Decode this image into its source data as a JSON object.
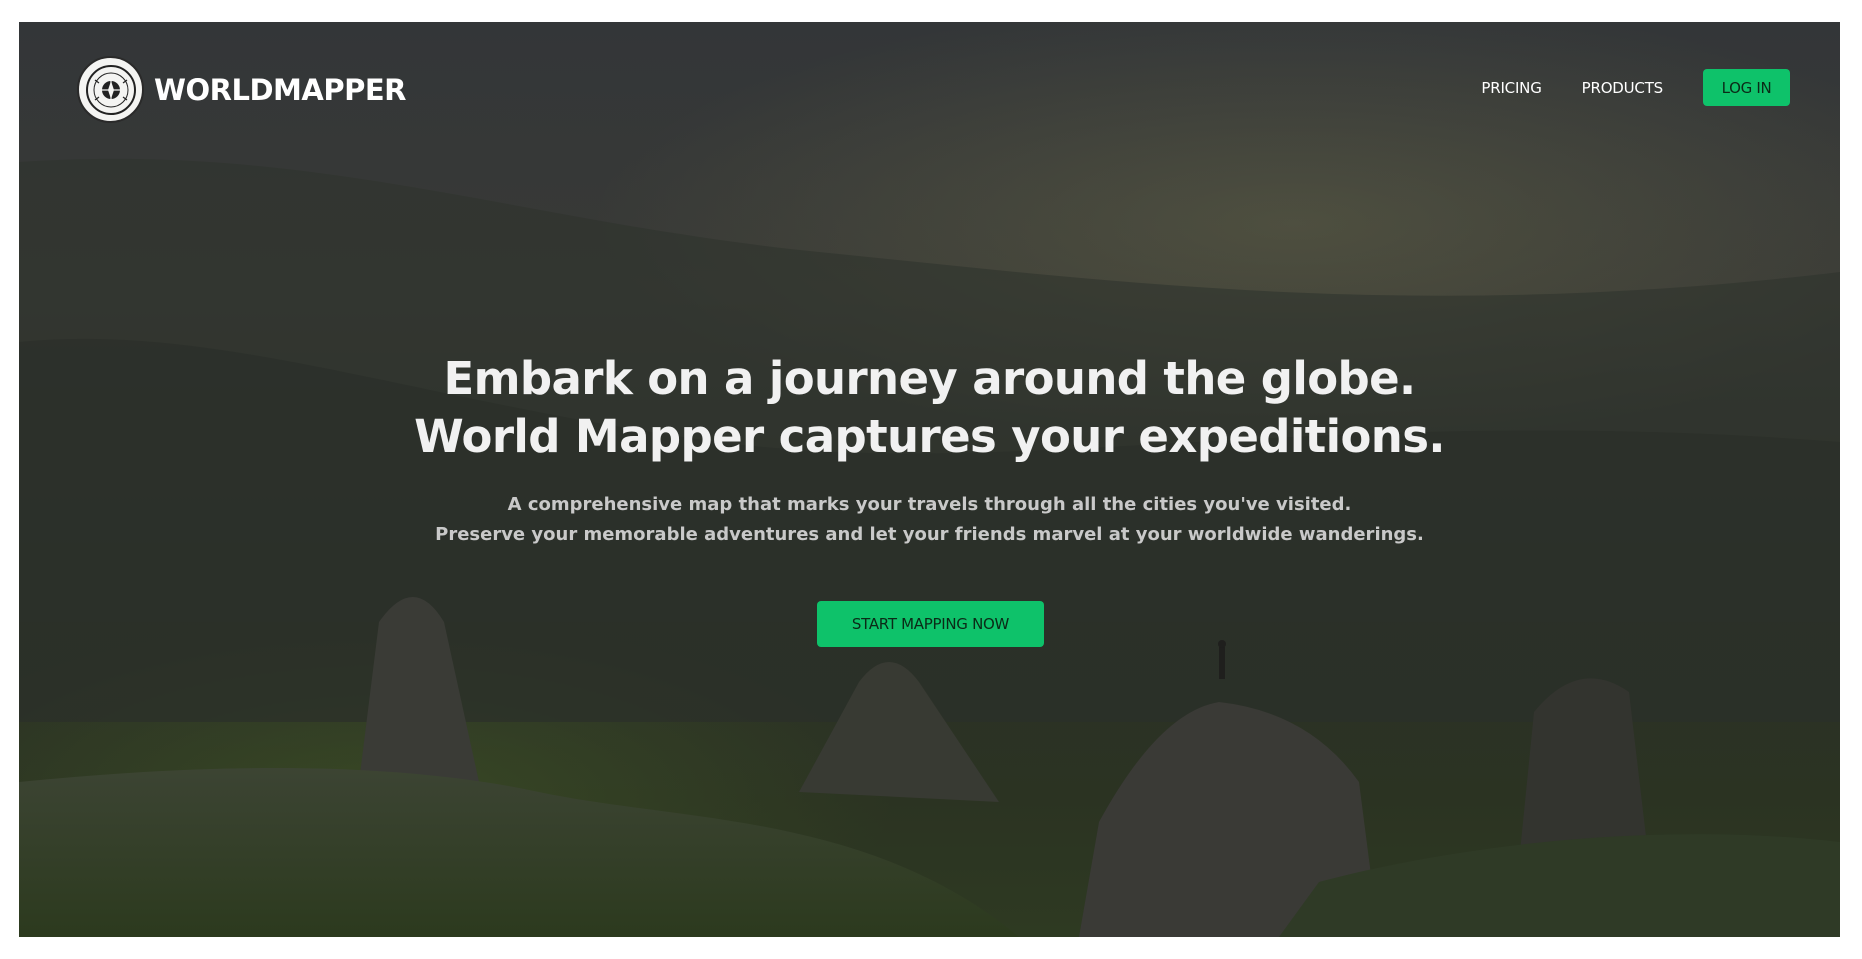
{
  "brand": {
    "name": "WORLDMAPPER",
    "logo_icon": "world-mapper-seal-icon"
  },
  "nav": {
    "pricing": "PRICING",
    "products": "PRODUCTS",
    "login": "LOG IN"
  },
  "hero": {
    "headline_line1": "Embark on a journey around the globe.",
    "headline_line2": "World Mapper captures your expeditions.",
    "sub_line1": "A comprehensive map that marks your travels through all the cities you've visited.",
    "sub_line2": "Preserve your memorable adventures and let your friends marvel at your worldwide wanderings.",
    "cta": "START MAPPING NOW"
  },
  "colors": {
    "accent": "#0ec26a",
    "overlay": "#333638"
  }
}
